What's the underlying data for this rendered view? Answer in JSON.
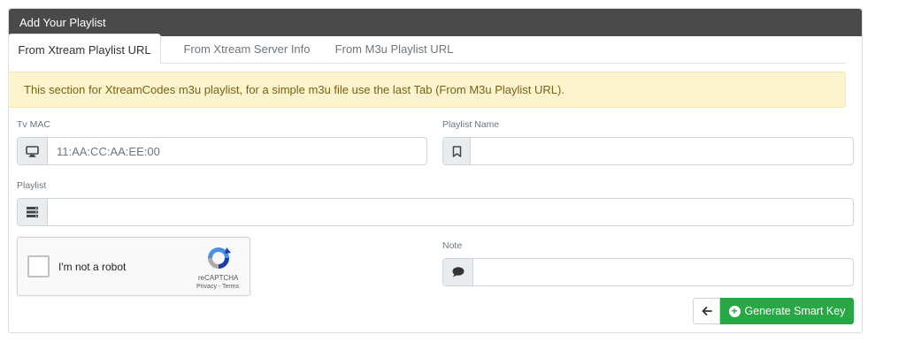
{
  "header": {
    "title": "Add Your Playlist"
  },
  "tabs": [
    {
      "label": "From Xtream Playlist URL"
    },
    {
      "label": "From Xtream Server Info"
    },
    {
      "label": "From M3u Playlist URL"
    }
  ],
  "alert": {
    "text": "This section for XtreamCodes m3u playlist, for a simple m3u file use the last Tab (From M3u Playlist URL)."
  },
  "form": {
    "tv_mac": {
      "label": "Tv MAC",
      "placeholder": "11:AA:CC:AA:EE:00",
      "icon": "monitor-icon"
    },
    "playlist_name": {
      "label": "Playlist Name",
      "placeholder": "",
      "icon": "bookmark-icon"
    },
    "playlist": {
      "label": "Playlist",
      "placeholder": "",
      "icon": "server-icon"
    },
    "note": {
      "label": "Note",
      "placeholder": "",
      "icon": "comment-icon"
    }
  },
  "captcha": {
    "label": "I'm not a robot",
    "brand": "reCAPTCHA",
    "links": "Privacy - Terms"
  },
  "actions": {
    "generate_label": "Generate Smart Key",
    "back_icon": "arrow-left-icon"
  },
  "colors": {
    "header_bg": "#4a4a4a",
    "alert_bg": "#fcf3cf",
    "button_green": "#28a745"
  }
}
